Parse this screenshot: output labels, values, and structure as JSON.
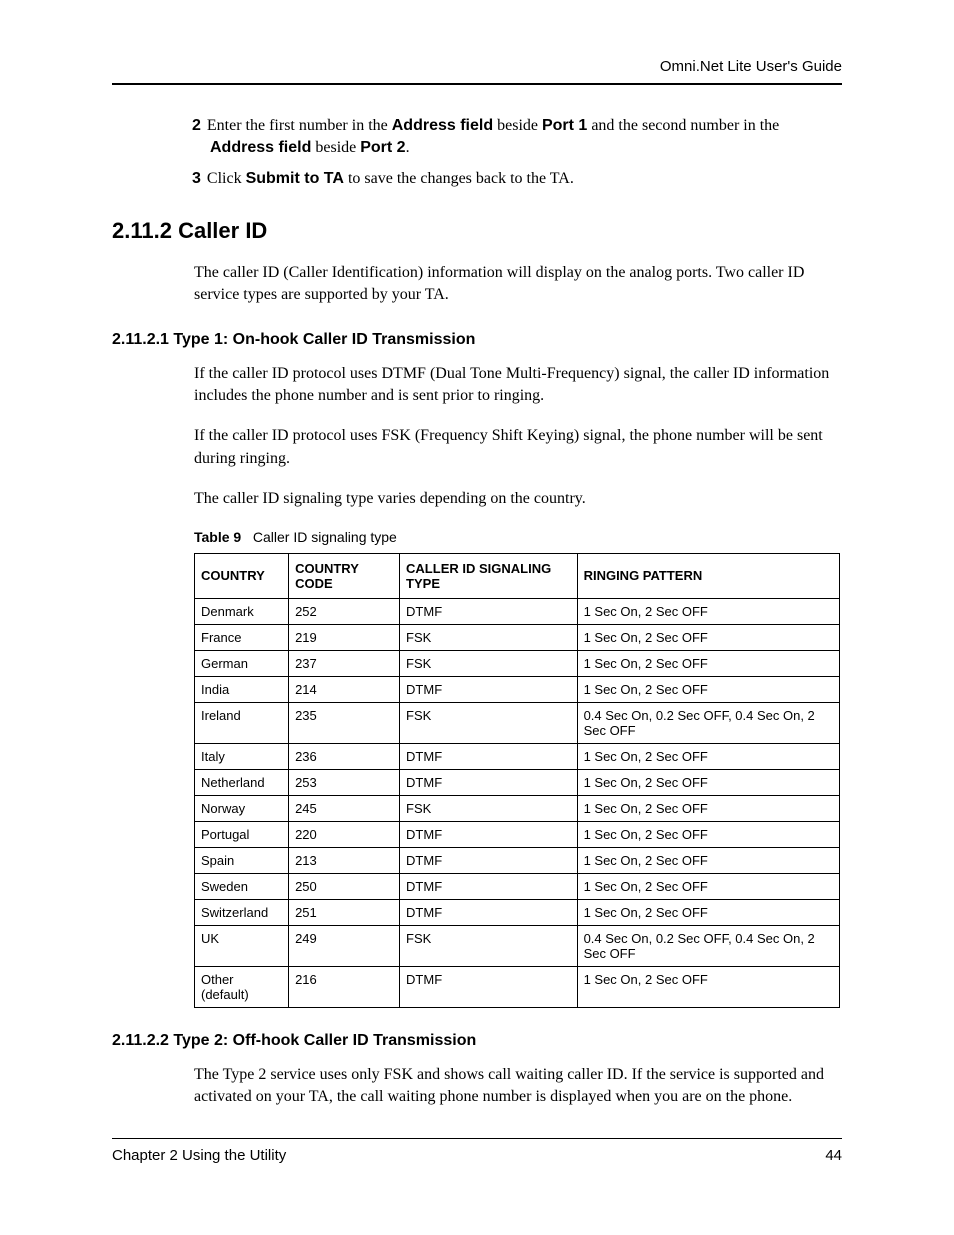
{
  "header": {
    "guide": "Omni.Net Lite User's Guide"
  },
  "steps": {
    "s2": {
      "num": "2",
      "pre": "Enter the first number in the ",
      "b1": "Address field",
      "mid1": " beside ",
      "b2": "Port 1",
      "mid2": " and the second number in the ",
      "b3": "Address field",
      "mid3": " beside ",
      "b4": "Port 2",
      "post": "."
    },
    "s3": {
      "num": "3",
      "pre": "Click ",
      "b1": "Submit to TA",
      "post": " to save the changes back to the TA."
    }
  },
  "section": {
    "h2": "2.11.2  Caller ID",
    "p1": "The caller ID (Caller Identification) information will display on the analog ports. Two caller ID service types are supported by your TA.",
    "h3a": "2.11.2.1  Type 1: On-hook Caller ID Transmission",
    "p2": "If the caller ID protocol uses DTMF (Dual Tone Multi-Frequency) signal, the caller ID information includes the phone number and is sent prior to ringing.",
    "p3": "If the caller ID protocol uses FSK (Frequency Shift Keying) signal, the phone number will be sent during ringing.",
    "p4": "The caller ID signaling type varies depending on the country.",
    "h3b": "2.11.2.2  Type 2: Off-hook Caller ID Transmission",
    "p5": "The Type 2 service uses only FSK and shows call waiting caller ID. If the service is supported and activated on your TA, the call waiting phone number is displayed when you are on the phone."
  },
  "table": {
    "caption_label": "Table 9",
    "caption_text": "Caller ID signaling type",
    "headers": [
      "COUNTRY",
      "COUNTRY CODE",
      "CALLER ID SIGNALING TYPE",
      "RINGING PATTERN"
    ],
    "rows": [
      [
        "Denmark",
        "252",
        "DTMF",
        "1 Sec On, 2 Sec OFF"
      ],
      [
        "France",
        "219",
        "FSK",
        "1 Sec On, 2 Sec OFF"
      ],
      [
        "German",
        "237",
        "FSK",
        "1 Sec On, 2 Sec OFF"
      ],
      [
        "India",
        "214",
        "DTMF",
        "1 Sec On, 2 Sec OFF"
      ],
      [
        "Ireland",
        "235",
        "FSK",
        "0.4 Sec On, 0.2 Sec OFF, 0.4 Sec On, 2 Sec OFF"
      ],
      [
        "Italy",
        "236",
        "DTMF",
        "1 Sec On, 2 Sec OFF"
      ],
      [
        "Netherland",
        "253",
        "DTMF",
        "1 Sec On, 2 Sec OFF"
      ],
      [
        "Norway",
        "245",
        "FSK",
        "1 Sec On, 2 Sec OFF"
      ],
      [
        "Portugal",
        "220",
        "DTMF",
        "1 Sec On, 2 Sec OFF"
      ],
      [
        "Spain",
        "213",
        "DTMF",
        "1 Sec On, 2 Sec OFF"
      ],
      [
        "Sweden",
        "250",
        "DTMF",
        "1 Sec On, 2 Sec OFF"
      ],
      [
        "Switzerland",
        "251",
        "DTMF",
        "1 Sec On, 2 Sec OFF"
      ],
      [
        "UK",
        "249",
        "FSK",
        "0.4 Sec On, 0.2 Sec OFF, 0.4 Sec On, 2 Sec OFF"
      ],
      [
        "Other (default)",
        "216",
        "DTMF",
        "1 Sec On, 2 Sec OFF"
      ]
    ]
  },
  "footer": {
    "chapter": "Chapter 2 Using the Utility",
    "page": "44"
  }
}
